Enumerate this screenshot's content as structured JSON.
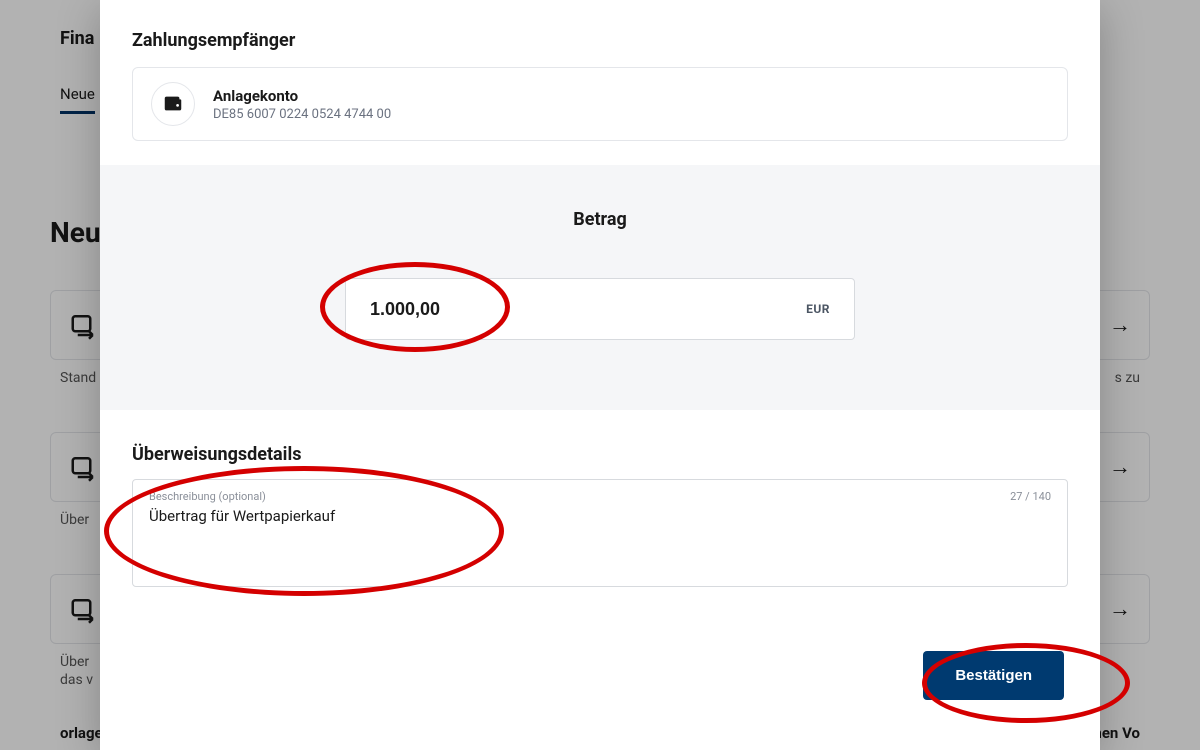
{
  "background": {
    "headerBrand": "Fina",
    "tab": "Neue",
    "heading": "Neu",
    "caption1": "Stand",
    "caption2": "Über",
    "caption3a": "Über",
    "caption3b": "das v",
    "rightBadge": "s zu",
    "bottomLeft": "orlage verwenden",
    "bottomRight": "Zu meinen Vo"
  },
  "modal": {
    "recipientTitle": "Zahlungsempfänger",
    "recipient": {
      "name": "Anlagekonto",
      "iban": "DE85 6007 0224 0524 4744 00"
    },
    "amountTitle": "Betrag",
    "amountValue": "1.000,00",
    "currency": "EUR",
    "detailsTitle": "Überweisungsdetails",
    "descLabel": "Beschreibung (optional)",
    "descValue": "Übertrag für Wertpapierkauf",
    "descCounter": "27 / 140",
    "confirm": "Bestätigen"
  }
}
